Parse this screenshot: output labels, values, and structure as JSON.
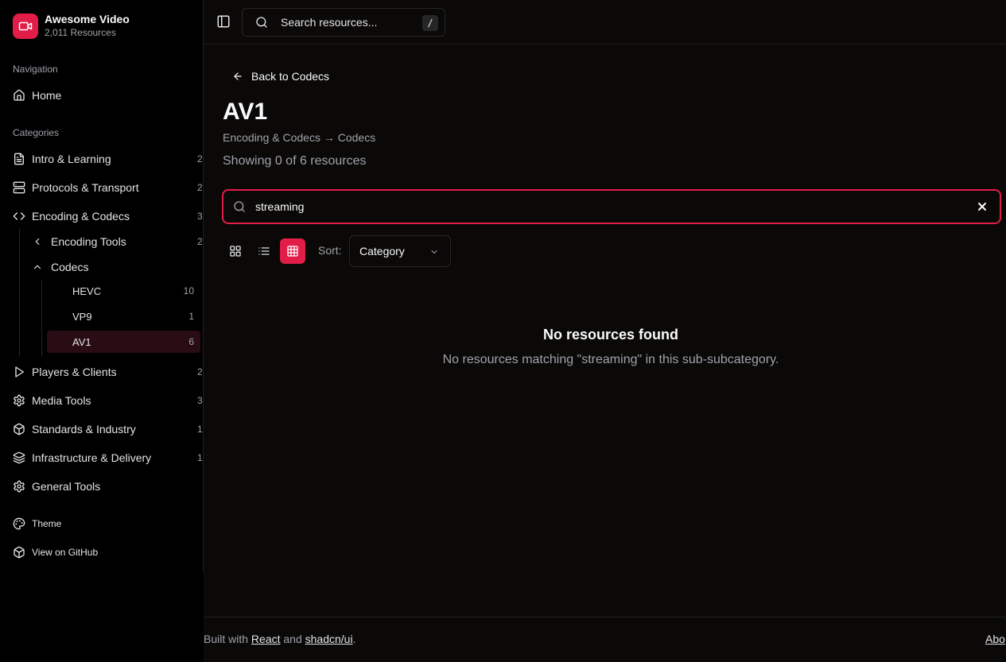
{
  "brand": {
    "title": "Awesome Video",
    "subtitle": "2,011 Resources"
  },
  "sidebar": {
    "nav_label": "Navigation",
    "home_label": "Home",
    "categories_label": "Categories",
    "categories": [
      {
        "label": "Intro & Learning",
        "count": "2",
        "icon": "file-text-icon"
      },
      {
        "label": "Protocols & Transport",
        "count": "2",
        "icon": "server-icon"
      },
      {
        "label": "Encoding & Codecs",
        "count": "3",
        "icon": "code-icon"
      },
      {
        "label": "Players & Clients",
        "count": "2",
        "icon": "play-icon"
      },
      {
        "label": "Media Tools",
        "count": "3",
        "icon": "gear-icon"
      },
      {
        "label": "Standards & Industry",
        "count": "1",
        "icon": "box-icon"
      },
      {
        "label": "Infrastructure & Delivery",
        "count": "1",
        "icon": "layers-icon"
      },
      {
        "label": "General Tools",
        "count": "",
        "icon": "gear-icon"
      }
    ],
    "subcategories": [
      {
        "label": "Encoding Tools",
        "count": "2",
        "icon": "chevron-left-icon"
      },
      {
        "label": "Codecs",
        "count": "",
        "icon": "chevron-up-icon"
      }
    ],
    "subsubcategories": [
      {
        "label": "HEVC",
        "count": "10"
      },
      {
        "label": "VP9",
        "count": "1"
      },
      {
        "label": "AV1",
        "count": "6",
        "active": true
      }
    ],
    "theme_label": "Theme",
    "github_label": "View on GitHub"
  },
  "topbar": {
    "search_placeholder": "Search resources...",
    "shortcut": "/"
  },
  "main": {
    "back_label": "Back to Codecs",
    "title": "AV1",
    "breadcrumb": "Encoding & Codecs → Codecs",
    "showing": "Showing 0 of 6 resources",
    "filter_value": "streaming",
    "sort_label": "Sort:",
    "sort_value": "Category",
    "empty_title": "No resources found",
    "empty_message": "No resources matching \"streaming\" in this sub-subcategory."
  },
  "footer": {
    "built_prefix": "Built with",
    "react": "React",
    "and": "and",
    "shadcn": "shadcn/ui",
    "period": ".",
    "about": "Abo"
  },
  "colors": {
    "accent": "#e11d48",
    "background": "#0a0908",
    "sidebar": "#000000",
    "muted": "#a1a1aa"
  }
}
